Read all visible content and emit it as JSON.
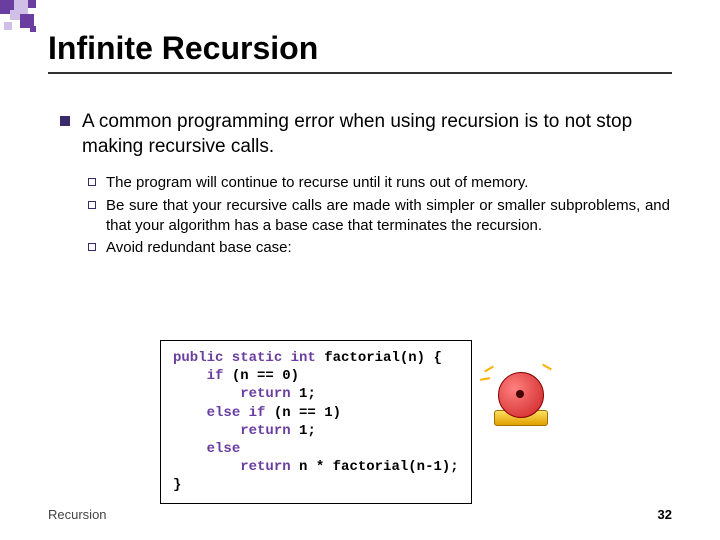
{
  "title": "Infinite Recursion",
  "main_bullet": "A common programming error when using recursion is to not stop making recursive calls.",
  "subs": {
    "s0": "The program will continue to recurse until it runs out of memory.",
    "s1": "Be sure that your recursive calls are made with simpler or smaller subproblems, and that your algorithm has a base case that terminates the recursion.",
    "s2": "Avoid redundant base case:"
  },
  "code": {
    "kw_sig": "public static int",
    "fn_sig": " factorial(n) {",
    "kw_if": "if",
    "cond1": " (n == 0)",
    "kw_ret1": "return",
    "ret1": " 1;",
    "kw_elseif": "else if",
    "cond2": " (n == 1)",
    "kw_ret2": "return",
    "ret2": " 1;",
    "kw_else": "else",
    "kw_ret3": "return",
    "ret3": " n * factorial(n-1);",
    "close": "}"
  },
  "footer": {
    "left": "Recursion",
    "right": "32"
  }
}
